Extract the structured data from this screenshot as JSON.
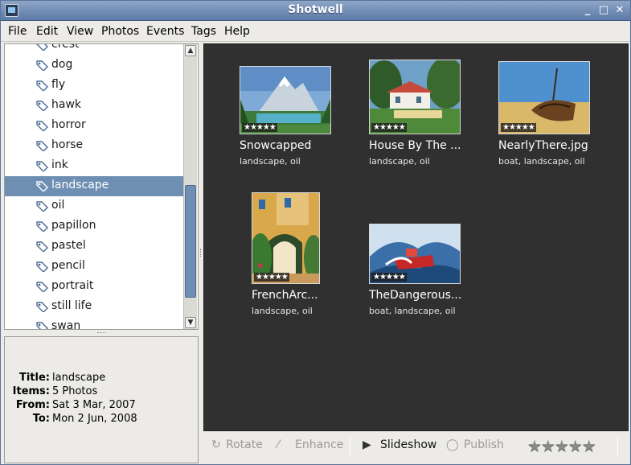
{
  "window": {
    "title": "Shotwell"
  },
  "menubar": [
    {
      "label": "File"
    },
    {
      "label": "Edit"
    },
    {
      "label": "View"
    },
    {
      "label": "Photos"
    },
    {
      "label": "Events"
    },
    {
      "label": "Tags"
    },
    {
      "label": "Help"
    }
  ],
  "sidebar": {
    "tags": [
      {
        "label": "crest"
      },
      {
        "label": "dog"
      },
      {
        "label": "fly"
      },
      {
        "label": "hawk"
      },
      {
        "label": "horror"
      },
      {
        "label": "horse"
      },
      {
        "label": "ink"
      },
      {
        "label": "landscape",
        "selected": true
      },
      {
        "label": "oil"
      },
      {
        "label": "papillon"
      },
      {
        "label": "pastel"
      },
      {
        "label": "pencil"
      },
      {
        "label": "portrait"
      },
      {
        "label": "still life"
      },
      {
        "label": "swan"
      }
    ]
  },
  "info": {
    "title_key": "Title:",
    "title_val": "landscape",
    "items_key": "Items:",
    "items_val": "5 Photos",
    "from_key": "From:",
    "from_val": "Sat 3 Mar, 2007",
    "to_key": "To:",
    "to_val": "Mon 2 Jun, 2008"
  },
  "photos": [
    {
      "title": "Snowcapped",
      "tags": "landscape, oil",
      "rating": "★★★★★"
    },
    {
      "title": "House By The ...",
      "tags": "landscape, oil",
      "rating": "★★★★★"
    },
    {
      "title": "NearlyThere.jpg",
      "tags": "boat, landscape, oil",
      "rating": "★★★★★"
    },
    {
      "title": "FrenchArc...",
      "tags": "landscape, oil",
      "rating": "★★★★★"
    },
    {
      "title": "TheDangerous...",
      "tags": "boat, landscape, oil",
      "rating": "★★★★★"
    }
  ],
  "toolbar": {
    "rotate": "Rotate",
    "enhance": "Enhance",
    "slideshow": "Slideshow",
    "publish": "Publish",
    "rating": "★★★★★"
  },
  "colors": {
    "selection": "#6f8fb2",
    "viewer_bg": "#303030",
    "titlebar": "#6f8cb5"
  }
}
